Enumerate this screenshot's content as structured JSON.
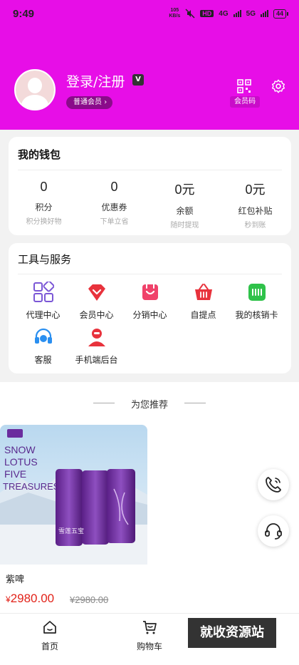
{
  "status_bar": {
    "time": "9:49",
    "net_speed_value": "105",
    "net_speed_unit": "KB/s",
    "hd": "HD",
    "sig1": "4G",
    "sig2": "5G",
    "battery": "44"
  },
  "profile": {
    "login_text": "登录/注册",
    "edit_badge": "V",
    "member_level": "普通会员",
    "member_code_label": "会员码"
  },
  "wallet": {
    "title": "我的钱包",
    "items": [
      {
        "value": "0",
        "label": "积分",
        "sub": "积分换好物"
      },
      {
        "value": "0",
        "label": "优惠券",
        "sub": "下单立省"
      },
      {
        "value": "0元",
        "label": "余额",
        "sub": "随时提现"
      },
      {
        "value": "0元",
        "label": "红包补贴",
        "sub": "秒到账"
      }
    ]
  },
  "tools": {
    "title": "工具与服务",
    "items": [
      {
        "label": "代理中心",
        "icon": "grid-icon"
      },
      {
        "label": "会员中心",
        "icon": "heart-diamond-icon"
      },
      {
        "label": "分销中心",
        "icon": "bag-smile-icon"
      },
      {
        "label": "自提点",
        "icon": "basket-icon"
      },
      {
        "label": "我的核销卡",
        "icon": "card-verify-icon"
      },
      {
        "label": "客服",
        "icon": "headset-icon"
      },
      {
        "label": "手机端后台",
        "icon": "admin-user-icon"
      }
    ]
  },
  "recommend": {
    "title": "为您推荐",
    "product": {
      "image_text": [
        "SNOW",
        "LOTUS",
        "FIVE",
        "TREASURES"
      ],
      "can_text": "雪莲五宝",
      "name": "紫啤",
      "currency": "¥",
      "price": "2980.00",
      "old_price": "¥2980.00"
    }
  },
  "tabbar": {
    "items": [
      {
        "label": "首页"
      },
      {
        "label": "购物车"
      }
    ]
  },
  "watermark": "就收资源站",
  "colors": {
    "header_bg": "#e70ee7",
    "price": "#e2231a",
    "badge_bg": "#8a0b8a"
  }
}
